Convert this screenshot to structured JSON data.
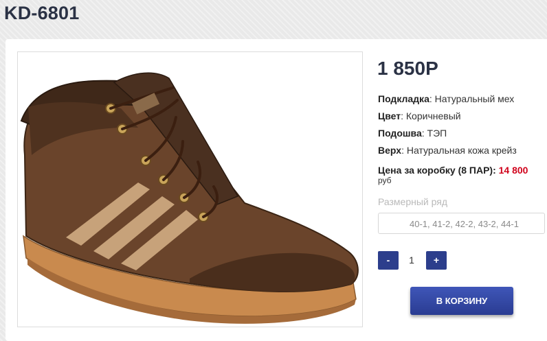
{
  "product": {
    "title": "KD-6801",
    "price": "1 850Р",
    "specs": [
      {
        "label": "Подкладка",
        "value": "Натуральный мех"
      },
      {
        "label": "Цвет",
        "value": "Коричневый"
      },
      {
        "label": "Подошва",
        "value": "ТЭП"
      },
      {
        "label": "Верх",
        "value": "Натуральная кожа крейз"
      }
    ],
    "box_price": {
      "label": "Цена за коробку (8 ПАР):",
      "value": "14 800",
      "currency": "руб"
    },
    "size_range": {
      "label": "Размерный ряд",
      "value": "40-1, 41-2, 42-2, 43-2, 44-1"
    },
    "quantity": {
      "minus_label": "-",
      "value": "1",
      "plus_label": "+"
    },
    "cart_button_label": "В КОРЗИНУ"
  },
  "colors": {
    "title": "#2b3245",
    "accent": "#2c3e8c",
    "price_red": "#d0021b",
    "leather": "#5a3a24",
    "stripe": "#c7a27a"
  }
}
